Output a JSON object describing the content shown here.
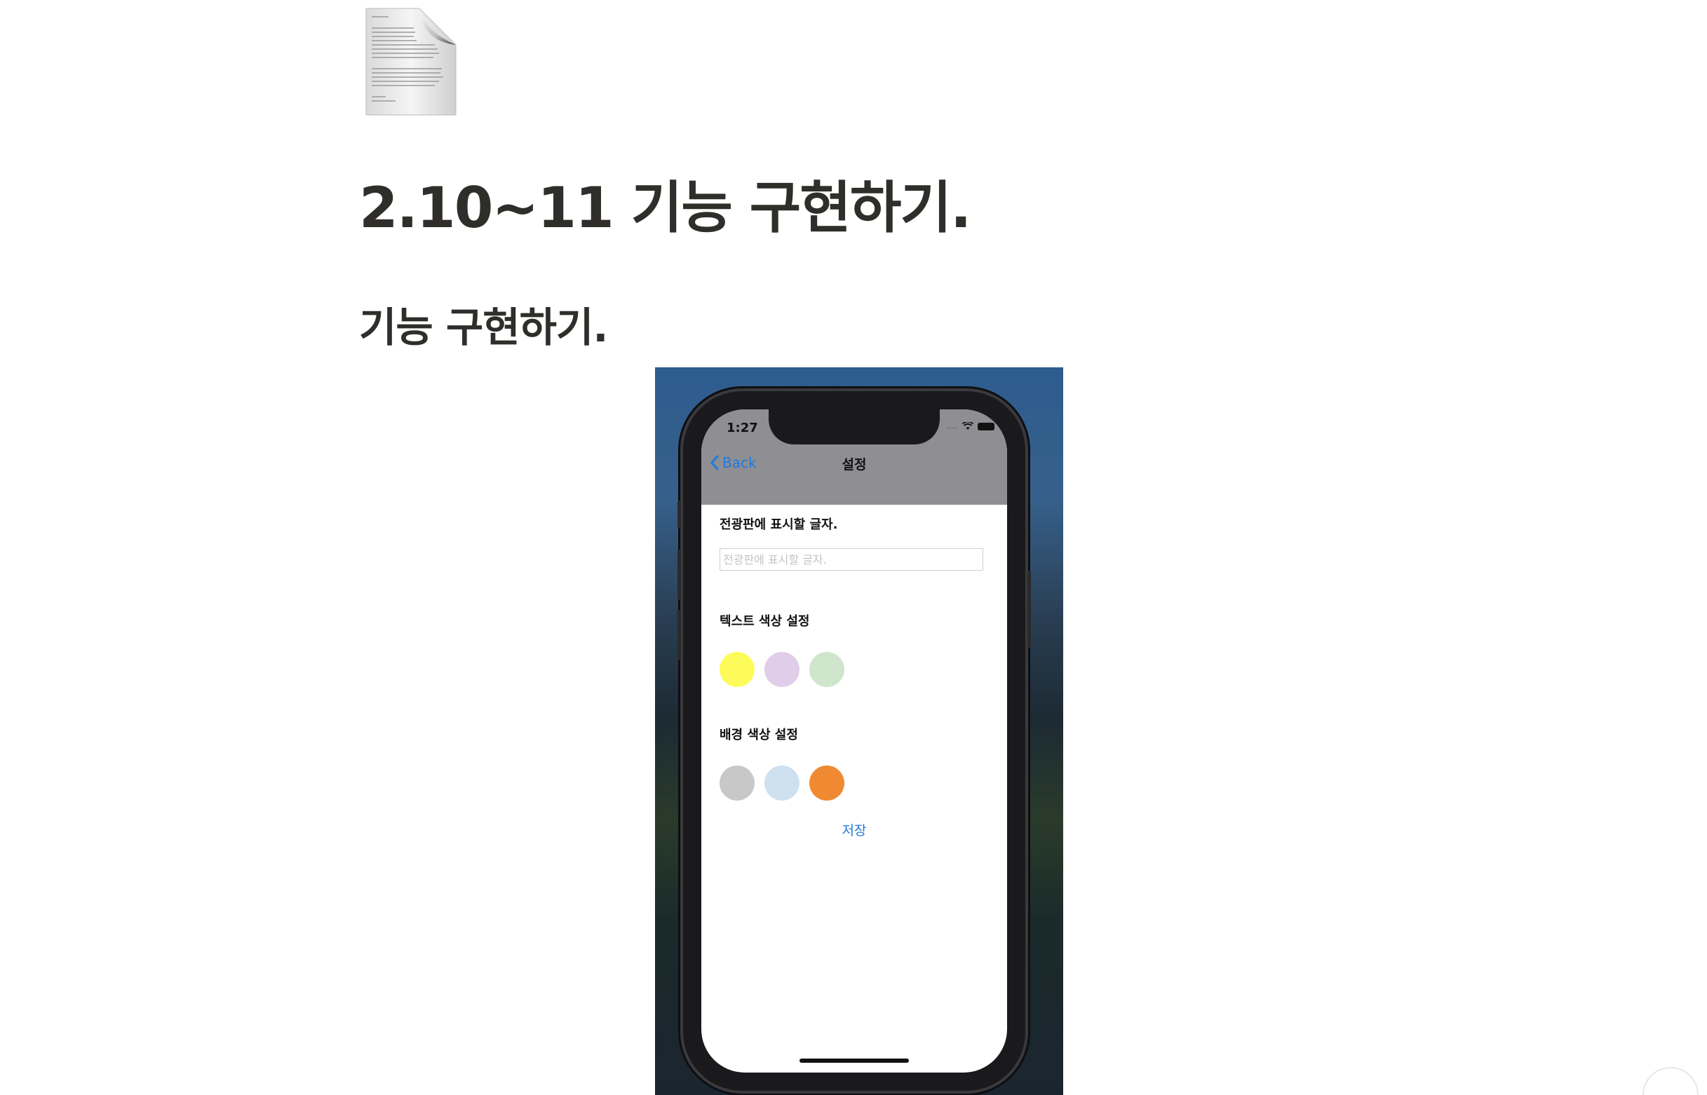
{
  "page": {
    "icon": "document-page-icon",
    "title": "2.10~11 기능 구현하기.",
    "section_heading": "기능 구현하기."
  },
  "simulator": {
    "status_bar": {
      "time": "1:27",
      "signal": "....",
      "icons": [
        "wifi-icon",
        "battery-icon"
      ]
    },
    "nav": {
      "back_label": "Back",
      "title": "설정"
    },
    "board_text": {
      "label": "전광판에 표시할 글자.",
      "placeholder": "전광판에 표시할 글자.",
      "value": ""
    },
    "text_color": {
      "label": "텍스트 색상 설정",
      "options": [
        "#fdfb5a",
        "#dfcdea",
        "#cfe6cc"
      ]
    },
    "background_color": {
      "label": "배경 색상 설정",
      "options": [
        "#c8c8c8",
        "#cfe0ee",
        "#f08a32"
      ]
    },
    "save_label": "저장"
  }
}
